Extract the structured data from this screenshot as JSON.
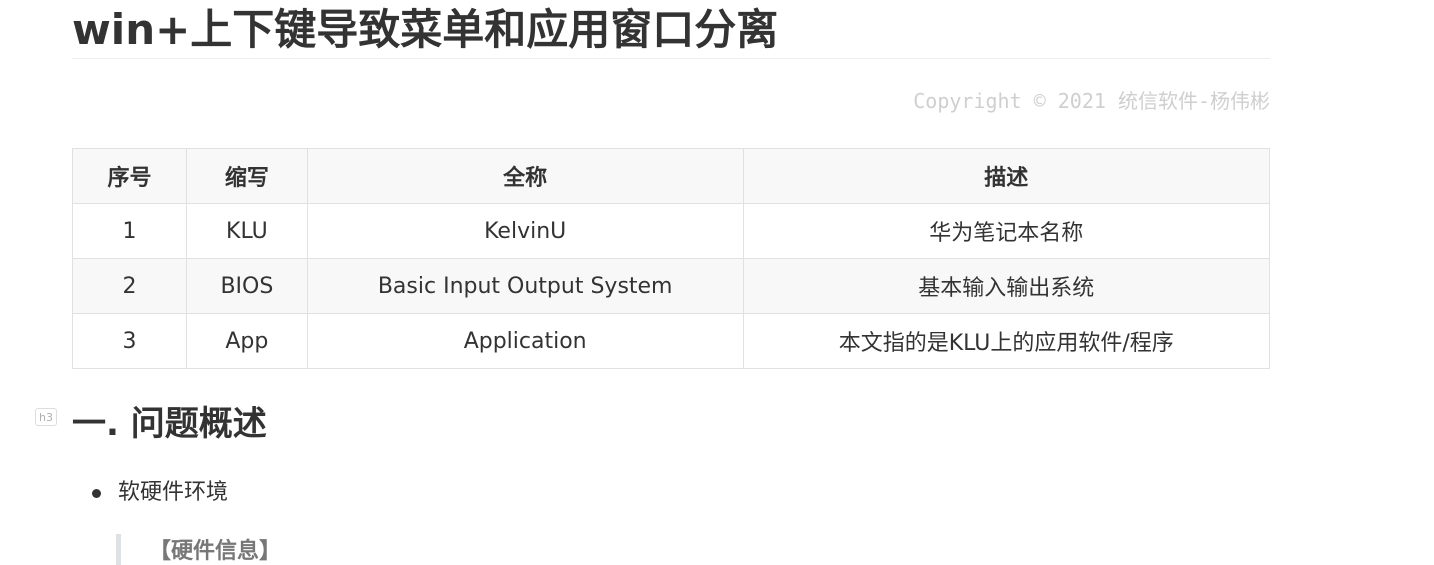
{
  "document": {
    "title": "win+上下键导致菜单和应用窗口分离",
    "copyright": "Copyright © 2021 统信软件-杨伟彬"
  },
  "table": {
    "headers": [
      "序号",
      "缩写",
      "全称",
      "描述"
    ],
    "rows": [
      [
        "1",
        "KLU",
        "KelvinU",
        "华为笔记本名称"
      ],
      [
        "2",
        "BIOS",
        "Basic Input Output System",
        "基本输入输出系统"
      ],
      [
        "3",
        "App",
        "Application",
        "本文指的是KLU上的应用软件/程序"
      ]
    ]
  },
  "section": {
    "heading_marker": "h3",
    "heading": "一. 问题概述",
    "bullets": [
      "软硬件环境"
    ],
    "quote": "【硬件信息】"
  }
}
